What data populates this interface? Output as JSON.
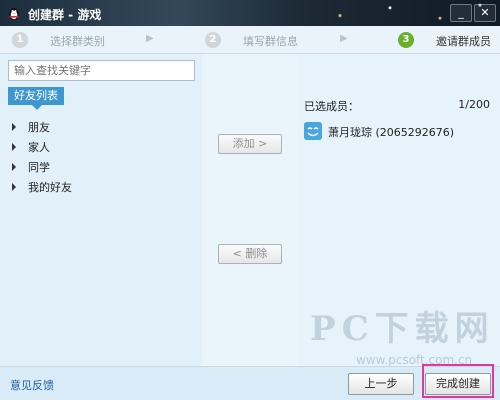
{
  "window": {
    "title": "创建群 - 游戏",
    "controls": {
      "minimize": "_",
      "close": "✕"
    }
  },
  "steps": [
    {
      "number": "1",
      "label": "选择群类别",
      "active": false
    },
    {
      "number": "2",
      "label": "填写群信息",
      "active": false
    },
    {
      "number": "3",
      "label": "邀请群成员",
      "active": true
    }
  ],
  "step_arrow": "▶",
  "search": {
    "placeholder": "输入查找关键字",
    "value": ""
  },
  "friend_list": {
    "tab_label": "好友列表",
    "groups": [
      {
        "label": "朋友"
      },
      {
        "label": "家人"
      },
      {
        "label": "同学"
      },
      {
        "label": "我的好友"
      }
    ]
  },
  "actions": {
    "add_label": "添加 >",
    "remove_label": "< 删除"
  },
  "selected": {
    "label": "已选成员：",
    "count": "1/200",
    "members": [
      {
        "name": "萧月珑琮 (2065292676)"
      }
    ]
  },
  "footer": {
    "feedback_label": "意见反馈",
    "prev_label": "上一步",
    "finish_label": "完成创建"
  },
  "watermark": {
    "main": "PC下载网",
    "url": "www.pcsoft.com.cn"
  },
  "colors": {
    "accent": "#3f97cf",
    "active_step": "#6bb02c",
    "highlight": "#e0389b",
    "link": "#1b5fa6"
  }
}
